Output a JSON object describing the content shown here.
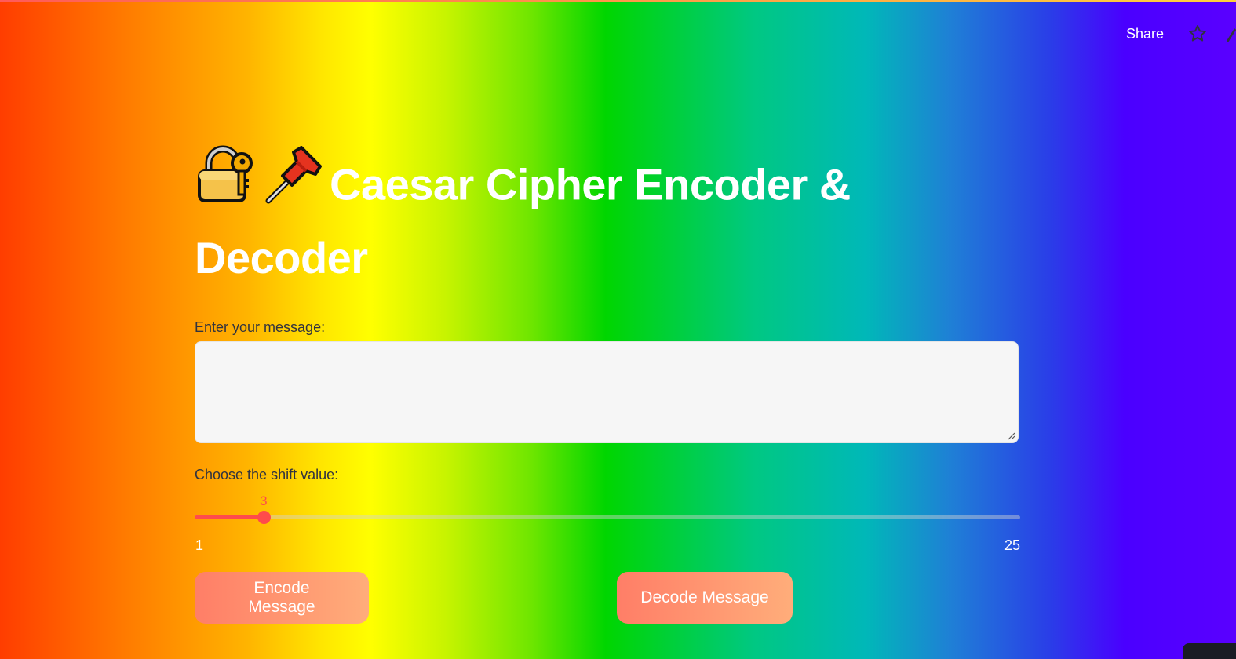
{
  "toolbar": {
    "share_label": "Share",
    "star_icon": "star-icon",
    "edge_icon": "edit-icon"
  },
  "main": {
    "title_emojis": [
      "lock-with-key-icon",
      "pushpin-icon"
    ],
    "title": "Caesar Cipher Encoder & Decoder",
    "message_label": "Enter your message:",
    "message_value": "",
    "shift_label": "Choose the shift value:",
    "shift": {
      "value": "3",
      "min": "1",
      "max": "25"
    },
    "encode_label": "Encode Message",
    "decode_label": "Decode Message"
  },
  "colors": {
    "accent": "#ff4b4b",
    "button_gradient_start": "#ff7e67",
    "button_gradient_end": "#ffad7a",
    "input_bg": "#f6f6f6"
  }
}
